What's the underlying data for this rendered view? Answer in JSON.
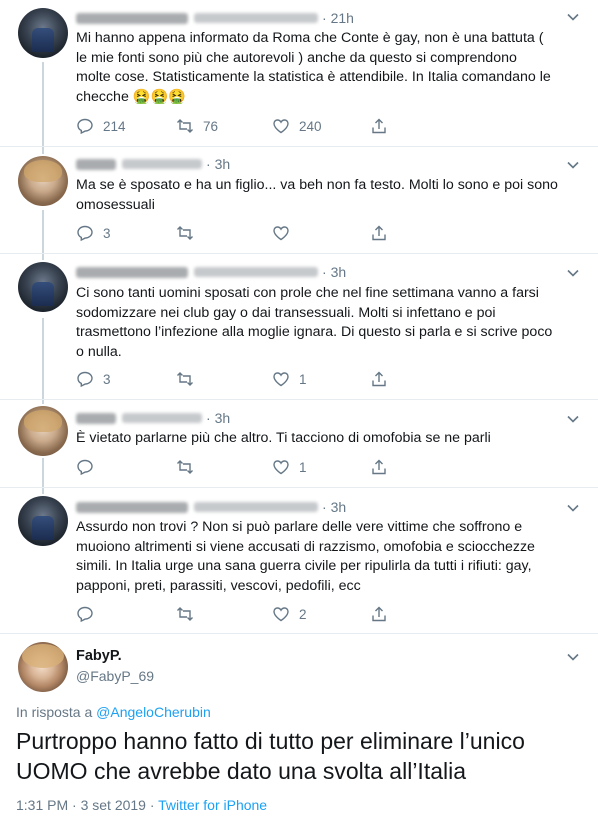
{
  "thread": [
    {
      "author": "angelo",
      "time": "21h",
      "text_lines": [
        "Mi hanno appena informato da Roma che Conte è gay, non  è una battuta (",
        "le mie fonti sono più che autorevoli ) anche da questo si comprendono",
        "molte cose. Statisticamente la statistica è attendibile. In Italia comandano le",
        "checche 🤮🤮🤮"
      ],
      "replies": "214",
      "retweets": "76",
      "likes": "240"
    },
    {
      "author": "faby",
      "time": "3h",
      "text_lines": [
        "Ma se è sposato e ha un figlio... va beh non fa testo. Molti lo sono e poi sono",
        "omosessuali"
      ],
      "replies": "3",
      "retweets": "",
      "likes": ""
    },
    {
      "author": "angelo",
      "time": "3h",
      "text_lines": [
        "Ci sono tanti uomini sposati con prole che nel fine settimana vanno a farsi",
        "sodomizzare nei club gay o dai transessuali. Molti si infettano e poi",
        "trasmettono l’infezione alla moglie ignara. Di questo si parla e si scrive poco",
        "o nulla."
      ],
      "replies": "3",
      "retweets": "",
      "likes": "1"
    },
    {
      "author": "faby",
      "time": "3h",
      "text_lines": [
        "È vietato parlarne più che altro. Ti tacciono di omofobia se ne parli"
      ],
      "replies": "",
      "retweets": "",
      "likes": "1"
    },
    {
      "author": "angelo",
      "time": "3h",
      "text_lines": [
        "Assurdo non trovi ? Non si può parlare delle vere vittime che soffrono e",
        "muoiono altrimenti si viene accusati di razzismo, omofobia e sciocchezze",
        "simili. In Italia urge una sana guerra civile per ripulirla da tutti i rifiuti: gay,",
        "papponi, preti, parassiti, vescovi, pedofili, ecc"
      ],
      "replies": "",
      "retweets": "",
      "likes": "2"
    }
  ],
  "main_tweet": {
    "name": "FabyP.",
    "handle": "@FabyP_69",
    "reply_prefix": "In risposta a ",
    "reply_to": "@AngeloCherubin",
    "text_line1": "Purtroppo hanno fatto di tutto per eliminare l’unico",
    "text_line2": "UOMO che avrebbe dato una svolta all’Italia",
    "timestamp": "1:31 PM · 3 set 2019 · ",
    "source": "Twitter for iPhone"
  },
  "colors": {
    "text": "#14171a",
    "secondary": "#657786",
    "link": "#1da1f2",
    "divider": "#e6ecf0"
  },
  "icons": {
    "reply": "reply-icon",
    "retweet": "retweet-icon",
    "like": "heart-icon",
    "share": "share-icon",
    "caret": "chevron-down-icon"
  }
}
